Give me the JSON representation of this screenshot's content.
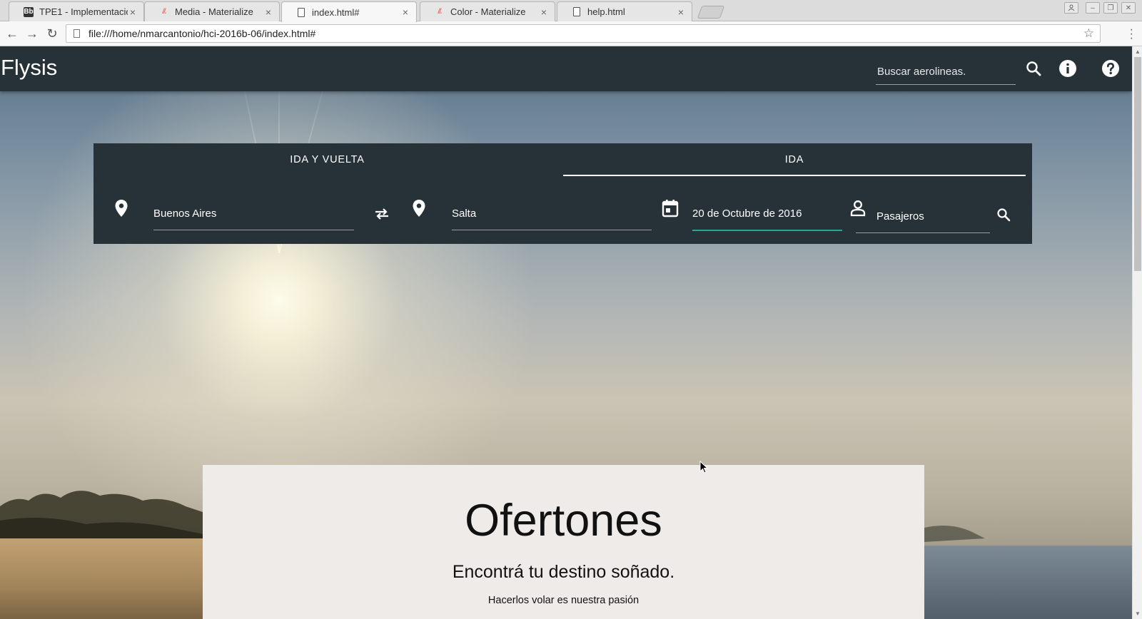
{
  "browser": {
    "tabs": [
      {
        "title": "TPE1 - Implementacio",
        "favicon": "bb-icon",
        "close": "×"
      },
      {
        "title": "Media - Materialize",
        "favicon": "materialize-icon",
        "close": "×"
      },
      {
        "title": "index.html#",
        "favicon": "file-icon",
        "close": "×",
        "active": true
      },
      {
        "title": "Color - Materialize",
        "favicon": "materialize-icon",
        "close": "×"
      },
      {
        "title": "help.html",
        "favicon": "file-icon",
        "close": "×"
      }
    ],
    "url": "file:///home/nmarcantonio/hci-2016b-06/index.html#"
  },
  "app": {
    "brand": "Flysis",
    "search_placeholder": "Buscar aerolineas.",
    "colors": {
      "navbar": "#263238",
      "active_underline": "#26a69a",
      "offers_bg": "#efebe9"
    }
  },
  "search_card": {
    "tabs": [
      "IDA Y VUELTA",
      "IDA"
    ],
    "active_tab": "IDA",
    "origin": "Buenos Aires",
    "destination": "Salta",
    "date": "20 de Octubre de 2016",
    "passengers_placeholder": "Pasajeros"
  },
  "offers": {
    "title": "Ofertones",
    "subtitle": "Encontrá tu destino soñado.",
    "tagline": "Hacerlos volar es nuestra pasión"
  }
}
